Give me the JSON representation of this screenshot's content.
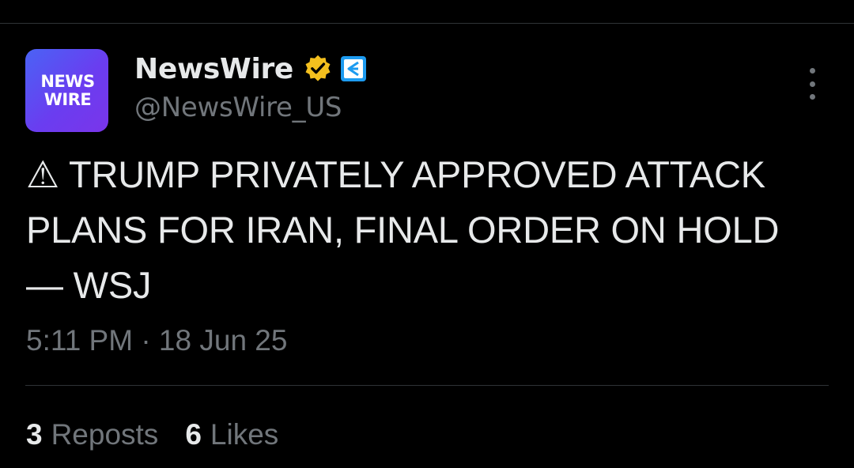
{
  "account": {
    "avatar_lines": [
      "NEWS",
      "WIRE"
    ],
    "display_name": "NewsWire",
    "handle": "@NewsWire_US",
    "verified_badge_icon": "verified-badge-icon",
    "affiliate_badge_icon": "affiliate-badge-icon",
    "badge_color": "#f4c01e"
  },
  "tweet": {
    "text": "⚠ TRUMP PRIVATELY APPROVED ATTACK PLANS FOR IRAN, FINAL ORDER ON HOLD — WSJ",
    "timestamp": "5:11 PM · 18 Jun 25"
  },
  "stats": {
    "reposts_count": "3",
    "reposts_label": "Reposts",
    "likes_count": "6",
    "likes_label": "Likes"
  },
  "colors": {
    "background": "#000000",
    "primary_text": "#e7e9ea",
    "secondary_text": "#71767b",
    "divider": "#2f3336",
    "avatar_gradient_start": "#4a63f5",
    "avatar_gradient_end": "#7a35ea",
    "affiliate_blue": "#1d9bf0"
  },
  "icons": {
    "more": "more-options-icon"
  }
}
